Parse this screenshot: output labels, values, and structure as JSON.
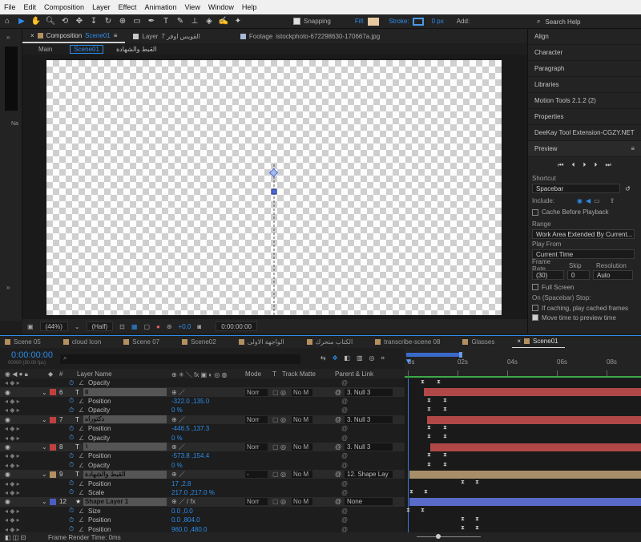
{
  "menu": [
    "File",
    "Edit",
    "Composition",
    "Layer",
    "Effect",
    "Animation",
    "View",
    "Window",
    "Help"
  ],
  "toolbar": {
    "snapping": "Snapping",
    "fill": "Fill:",
    "stroke": "Stroke:",
    "stroke_px": "0 px",
    "add": "Add:",
    "search_help": "Search Help"
  },
  "comp_tabs": {
    "comp_label": "Composition",
    "comp_name": "Scene01",
    "layer_label": "Layer",
    "layer_name": "7 القويس اوفر",
    "footage_label": "Footage",
    "footage_name": "istockphoto-672298630-170667a.jpg"
  },
  "comp_sub": {
    "main": "Main",
    "scene": "Scene01",
    "arabic": "القبط والشهادة"
  },
  "comp_footer": {
    "zoom": "(44%)",
    "quality": "(Half)",
    "exposure": "+0.0",
    "time": "0:00:00:00"
  },
  "right_panel": {
    "items": [
      "Align",
      "Character",
      "Paragraph",
      "Libraries",
      "Motion Tools 2.1.2 (2)",
      "Properties",
      "DeeKay Tool Extension-CGZY.NET"
    ],
    "preview_title": "Preview",
    "shortcut_label": "Shortcut",
    "shortcut_value": "Spacebar",
    "include_label": "Include:",
    "cache_before": "Cache Before Playback",
    "range_label": "Range",
    "range_value": "Work Area Extended By Current...",
    "play_from_label": "Play From",
    "play_from_value": "Current Time",
    "frame_rate_label": "Frame Rate",
    "skip_label": "Skip",
    "resolution_label": "Resolution",
    "frame_rate_value": "(30)",
    "skip_value": "0",
    "resolution_value": "Auto",
    "full_screen": "Full Screen",
    "on_stop": "On (Spacebar) Stop:",
    "if_caching": "If caching, play cached frames",
    "move_time": "Move time to preview time"
  },
  "timeline_tabs": [
    "Scene 05",
    "cloud Icon",
    "Scene 07",
    "Scene02",
    "الواجهة الاولى",
    "الكتاب متحرك",
    "transcribe-scene 08",
    "Glasses",
    "Scene01"
  ],
  "timeline_tab_colors": [
    "#b39060",
    "#b39060",
    "#b39060",
    "#b39060",
    "#b39060",
    "#b39060",
    "#b39060",
    "#b39060",
    "#b39060"
  ],
  "timeline": {
    "timecode": "0:00:00:00",
    "fps": "00000 (30.00 fps)",
    "col_layer_name": "Layer Name",
    "col_mode": "Mode",
    "col_t": "T",
    "col_track_matte": "Track Matte",
    "col_parent": "Parent & Link",
    "ruler": [
      "0s",
      "02s",
      "04s",
      "06s",
      "08s"
    ],
    "footer": "Frame Render Time:  0ms"
  },
  "rows": [
    {
      "kind": "prop",
      "name": "Opacity",
      "value": ""
    },
    {
      "kind": "layer",
      "num": "6",
      "name": "٥",
      "label_color": "#c04040",
      "mode": "Norr",
      "matte": "No M",
      "parent": "3. Null 3"
    },
    {
      "kind": "prop",
      "name": "Position",
      "value": "-322.0 ,135.0"
    },
    {
      "kind": "prop",
      "name": "Opacity",
      "value": "0 %"
    },
    {
      "kind": "layer",
      "num": "7",
      "name": "دكتوراه",
      "label_color": "#c04040",
      "mode": "Norr",
      "matte": "No M",
      "parent": "3. Null 3"
    },
    {
      "kind": "prop",
      "name": "Position",
      "value": "-446.5 ,137.3"
    },
    {
      "kind": "prop",
      "name": "Opacity",
      "value": "0 %"
    },
    {
      "kind": "layer",
      "num": "8",
      "name": "١",
      "label_color": "#c04040",
      "mode": "Norr",
      "matte": "No M",
      "parent": "3. Null 3"
    },
    {
      "kind": "prop",
      "name": "Position",
      "value": "-573.8 ,154.4"
    },
    {
      "kind": "prop",
      "name": "Opacity",
      "value": "0 %"
    },
    {
      "kind": "layer",
      "num": "9",
      "name": "القبط والشهادة",
      "label_color": "#b39060",
      "mode": "-",
      "matte": "No M",
      "parent": "12. Shape Lay"
    },
    {
      "kind": "prop",
      "name": "Position",
      "value": "17 ,2.8"
    },
    {
      "kind": "prop",
      "name": "Scale",
      "value": "217.0 ,217.0 %"
    },
    {
      "kind": "layer",
      "num": "12",
      "name": "Shape Layer 1",
      "label_color": "#4a5fc0",
      "mode": "Norr",
      "matte": "No M",
      "parent": "None"
    },
    {
      "kind": "prop",
      "name": "Size",
      "value": "0.0 ,0.0"
    },
    {
      "kind": "prop",
      "name": "Position",
      "value": "0.0 ,804.0"
    },
    {
      "kind": "prop",
      "name": "Position",
      "value": "960.0 ,480.0"
    }
  ]
}
